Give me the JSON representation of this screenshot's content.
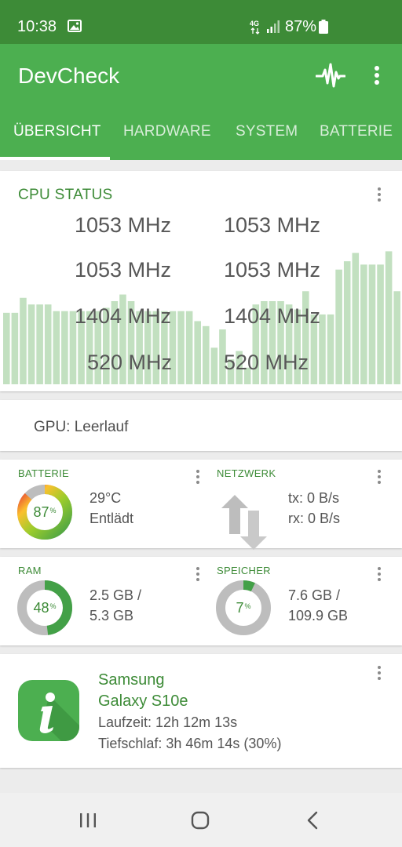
{
  "status_bar": {
    "time": "10:38",
    "network": "4G",
    "battery_percent": "87%",
    "icons": [
      "gallery-icon",
      "network-4g-icon",
      "signal-icon",
      "battery-icon"
    ]
  },
  "app_bar": {
    "title": "DevCheck",
    "actions": [
      "pulse-icon",
      "overflow-menu-icon"
    ]
  },
  "tabs": [
    {
      "label": "ÜBERSICHT",
      "active": true
    },
    {
      "label": "HARDWARE",
      "active": false
    },
    {
      "label": "SYSTEM",
      "active": false
    },
    {
      "label": "BATTERIE",
      "active": false
    }
  ],
  "cpu_status": {
    "title": "CPU STATUS",
    "frequencies": [
      "1053 MHz",
      "1053 MHz",
      "1053 MHz",
      "1053 MHz",
      "1404 MHz",
      "1404 MHz",
      "520 MHz",
      "520 MHz"
    ],
    "bar_color": "#c2e0c0"
  },
  "chart_data": {
    "type": "bar",
    "series": [
      {
        "values": [
          0.43,
          0.43,
          0.52,
          0.48,
          0.48,
          0.48,
          0.44,
          0.44,
          0.44,
          0.44,
          0.44,
          0.44,
          0.46,
          0.5,
          0.54,
          0.5,
          0.44,
          0.44,
          0.44,
          0.44,
          0.44,
          0.44,
          0.44,
          0.38,
          0.35,
          0.22,
          0.33,
          0.15,
          0.2,
          0.1,
          0.48,
          0.5,
          0.5,
          0.5,
          0.48,
          0.45,
          0.56,
          0.42,
          0.42,
          0.42,
          0.69,
          0.74,
          0.79,
          0.72,
          0.72,
          0.72,
          0.8,
          0.56
        ]
      }
    ],
    "ylim": [
      0,
      1
    ]
  },
  "gpu": {
    "label": "GPU: Leerlauf"
  },
  "battery": {
    "title": "BATTERIE",
    "percent_value": 87,
    "percent_number": "87",
    "percent_sign": "%",
    "temperature": "29°C",
    "state": "Entlädt"
  },
  "network": {
    "title": "NETZWERK",
    "tx": "tx: 0 B/s",
    "rx": "rx: 0 B/s"
  },
  "ram": {
    "title": "RAM",
    "percent_value": 48,
    "percent_number": "48",
    "percent_sign": "%",
    "used": "2.5 GB /",
    "total": "5.3 GB"
  },
  "storage": {
    "title": "SPEICHER",
    "percent_value": 7,
    "percent_number": "7",
    "percent_sign": "%",
    "used": "7.6 GB /",
    "total": "109.9 GB"
  },
  "device": {
    "brand": "Samsung",
    "model": "Galaxy S10e",
    "uptime": "Laufzeit: 12h 12m 13s",
    "deep_sleep": "Tiefschlaf: 3h 46m 14s (30%)"
  },
  "colors": {
    "status_bar": "#3d8b37",
    "app_bar": "#4caf50",
    "accent": "#3d8b37",
    "ring_track": "#bdbdbd",
    "ring_green": "#43a047"
  },
  "nav_bar": {
    "buttons": [
      "recent-apps-icon",
      "home-icon",
      "back-icon"
    ]
  }
}
